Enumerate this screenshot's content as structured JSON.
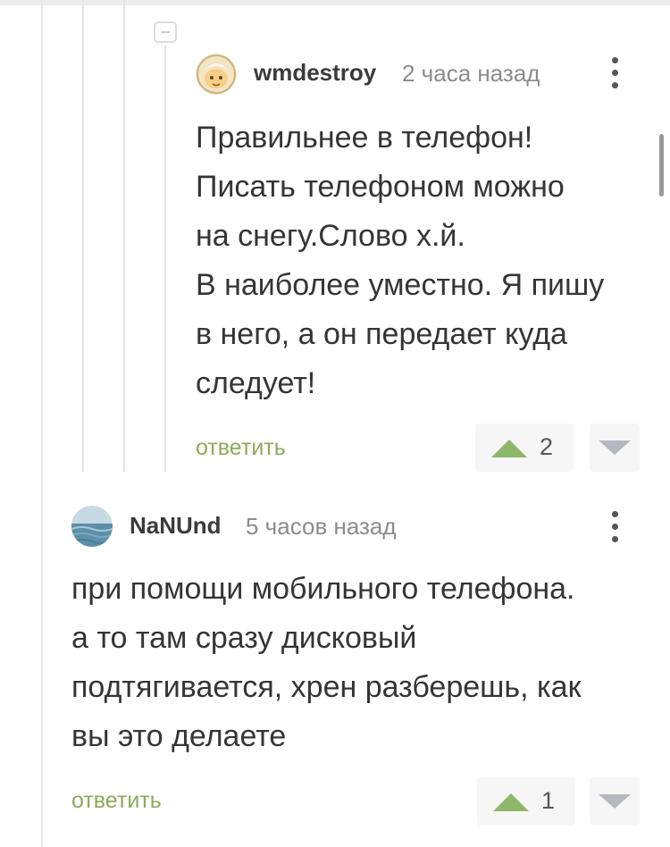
{
  "comments": [
    {
      "username": "wmdestroy",
      "time": "2 часа назад",
      "lines": [
        "Правильнее в телефон!",
        "Писать телефоном можно",
        "на снегу.Слово х.й.",
        "В наиболее уместно. Я пишу",
        "в него, а он передает куда",
        "следует!"
      ],
      "reply_label": "ответить",
      "rating": "2"
    },
    {
      "username": "NaNUnd",
      "time": "5 часов назад",
      "lines": [
        "при помощи мобильного телефона.",
        "а то там сразу дисковый",
        "подтягивается, хрен разберешь, как",
        "вы это делаете"
      ],
      "reply_label": "ответить",
      "rating": "1"
    }
  ],
  "colors": {
    "accent_green": "#8aac59",
    "upvote_green": "#8fb76a",
    "downvote_grey": "#b4b8bf"
  },
  "icons": [
    "collapse-icon",
    "avatar-cartoon",
    "avatar-sea",
    "more-vertical-icon",
    "upvote-icon",
    "downvote-icon"
  ]
}
